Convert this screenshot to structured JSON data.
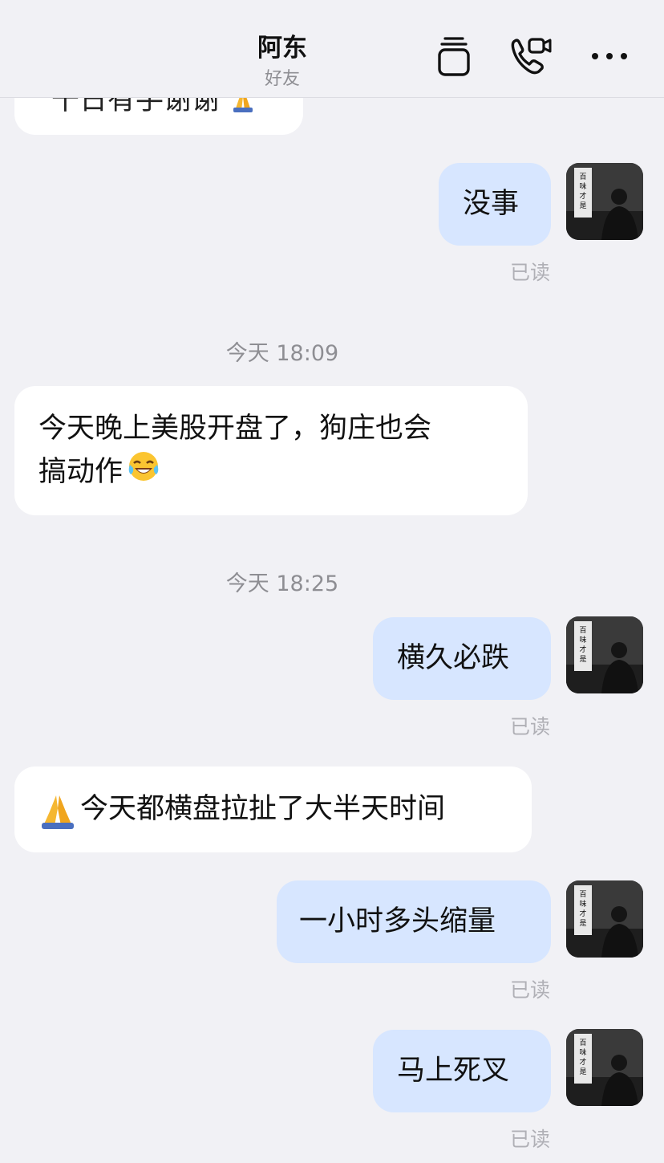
{
  "header": {
    "contact_name": "阿东",
    "contact_status": "好友",
    "icons": [
      "stack-icon",
      "video-call-icon",
      "more-icon"
    ]
  },
  "messages": [
    {
      "type": "in",
      "text": "千日有手谢谢",
      "emoji": "pray-emoji"
    },
    {
      "type": "out",
      "text": "没事",
      "status": "已读"
    },
    {
      "type": "time",
      "text": "今天 18:09"
    },
    {
      "type": "in",
      "line1": "今天晚上美股开盘了，狗庄也会",
      "line2": "搞动作",
      "emoji": "laugh-cry-emoji"
    },
    {
      "type": "time",
      "text": "今天 18:25"
    },
    {
      "type": "out",
      "text": "横久必跌",
      "status": "已读"
    },
    {
      "type": "in",
      "text": "今天都横盘拉扯了大半天时间",
      "emoji": "pray-emoji"
    },
    {
      "type": "out",
      "text": "一小时多头缩量",
      "status": "已读"
    },
    {
      "type": "out",
      "text": "马上死叉",
      "status": "已读"
    }
  ],
  "avatar": {
    "caption": "百味才是人生"
  },
  "colors": {
    "background": "#f1f1f5",
    "incoming": "#ffffff",
    "outgoing": "#d7e6ff",
    "muted": "#8e8e93"
  }
}
